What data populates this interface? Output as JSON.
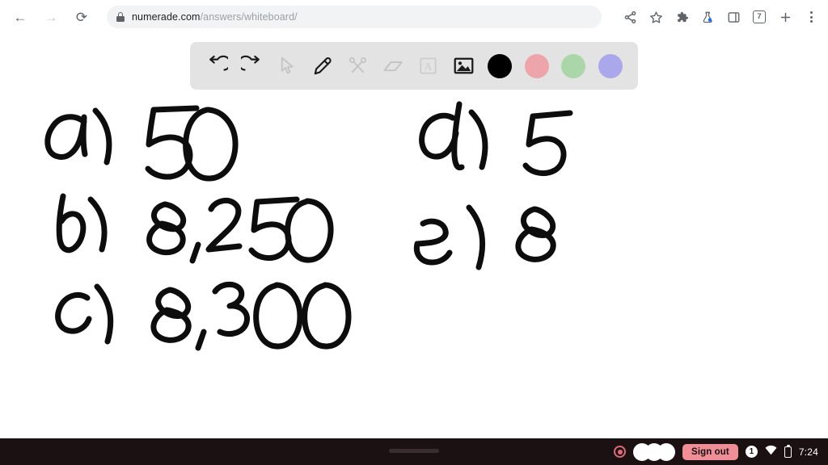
{
  "browser": {
    "nav": [
      {
        "name": "back-button",
        "glyph": "←",
        "enabled": true
      },
      {
        "name": "forward-button",
        "glyph": "→",
        "enabled": false
      },
      {
        "name": "reload-button",
        "glyph": "⟳",
        "enabled": true
      }
    ],
    "address": {
      "host": "numerade.com",
      "path": "/answers/whiteboard/",
      "full_url": "numerade.com/answers/whiteboard/",
      "security_icon": "lock-icon"
    },
    "right_icons": [
      {
        "name": "share-icon",
        "label": "Share"
      },
      {
        "name": "bookmark-star-icon",
        "label": "Bookmark this tab"
      },
      {
        "name": "extensions-puzzle-icon",
        "label": "Extensions"
      },
      {
        "name": "labs-flask-icon",
        "label": "Chrome Labs"
      },
      {
        "name": "side-panel-icon",
        "label": "Side panel"
      },
      {
        "name": "tab-counter-icon",
        "label": "7"
      },
      {
        "name": "new-tab-plus-icon",
        "label": "New tab"
      },
      {
        "name": "chrome-menu-kebab-icon",
        "label": "Customize and control Chrome"
      }
    ],
    "tab_count": "7"
  },
  "whiteboard": {
    "toolbar": {
      "tools": [
        {
          "name": "undo-tool",
          "label": "Undo",
          "state": "enabled"
        },
        {
          "name": "redo-tool",
          "label": "Redo",
          "state": "enabled"
        },
        {
          "name": "select-cursor-tool",
          "label": "Select",
          "state": "disabled"
        },
        {
          "name": "pencil-tool",
          "label": "Pencil",
          "state": "active"
        },
        {
          "name": "scissors-tool",
          "label": "Cut",
          "state": "disabled"
        },
        {
          "name": "eraser-tool",
          "label": "Eraser",
          "state": "disabled"
        },
        {
          "name": "text-tool",
          "label": "Text",
          "state": "disabled"
        },
        {
          "name": "image-tool",
          "label": "Insert image",
          "state": "enabled"
        }
      ],
      "colors": [
        {
          "name": "color-swatch-black",
          "label": "Black",
          "hex": "#000000",
          "selected": true
        },
        {
          "name": "color-swatch-pink",
          "label": "Pink",
          "hex": "#eda4ab",
          "selected": false
        },
        {
          "name": "color-swatch-green",
          "label": "Green",
          "hex": "#abd6aa",
          "selected": false
        },
        {
          "name": "color-swatch-purple",
          "label": "Purple",
          "hex": "#aaa7ea",
          "selected": false
        }
      ]
    },
    "ink_color": "#0d0d0d",
    "answers": [
      {
        "label": "a)",
        "value": "50"
      },
      {
        "label": "b)",
        "value": "8,250"
      },
      {
        "label": "c)",
        "value": "8,300"
      },
      {
        "label": "d)",
        "value": "5"
      },
      {
        "label": "e)",
        "value": "8"
      }
    ]
  },
  "shelf": {
    "recording_icon": "screen-record-icon",
    "avatar_count": 3,
    "sign_out_label": "Sign out",
    "notification_count": "1",
    "wifi_icon": "wifi-icon",
    "battery_icon": "battery-icon",
    "time": "7:24",
    "background": "#1b1113",
    "accent": "#ef8e96"
  }
}
